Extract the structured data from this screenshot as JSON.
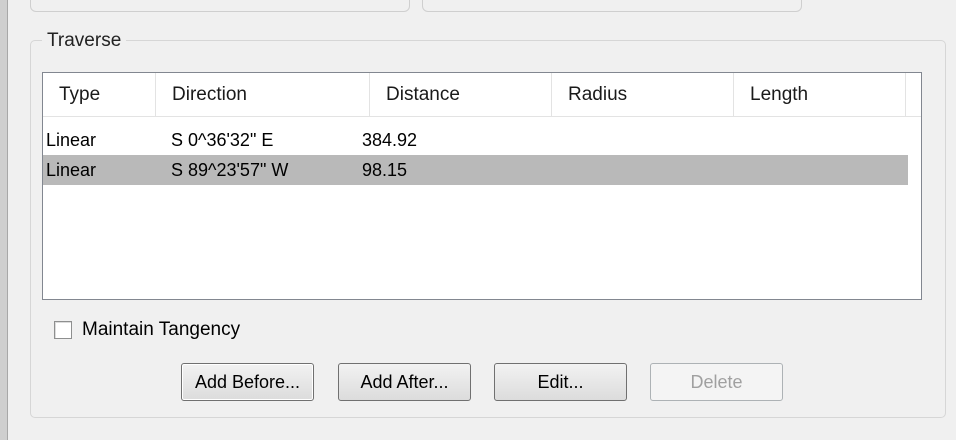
{
  "group": {
    "title": "Traverse"
  },
  "list": {
    "columns": [
      "Type",
      "Direction",
      "Distance",
      "Radius",
      "Length"
    ],
    "rows": [
      {
        "type": "Linear",
        "direction": "S  0^36'32\" E",
        "distance": "384.92",
        "radius": "",
        "length": "",
        "selected": false
      },
      {
        "type": "Linear",
        "direction": "S 89^23'57\" W",
        "distance": "98.15",
        "radius": "",
        "length": "",
        "selected": true
      }
    ]
  },
  "options": {
    "maintain_tangency_label": "Maintain Tangency",
    "maintain_tangency_checked": false
  },
  "buttons": {
    "add_before": "Add Before...",
    "add_after": "Add After...",
    "edit": "Edit...",
    "delete": "Delete"
  },
  "colors": {
    "selection": "#b9b9b9",
    "disabled_text": "#a0a0a0"
  }
}
